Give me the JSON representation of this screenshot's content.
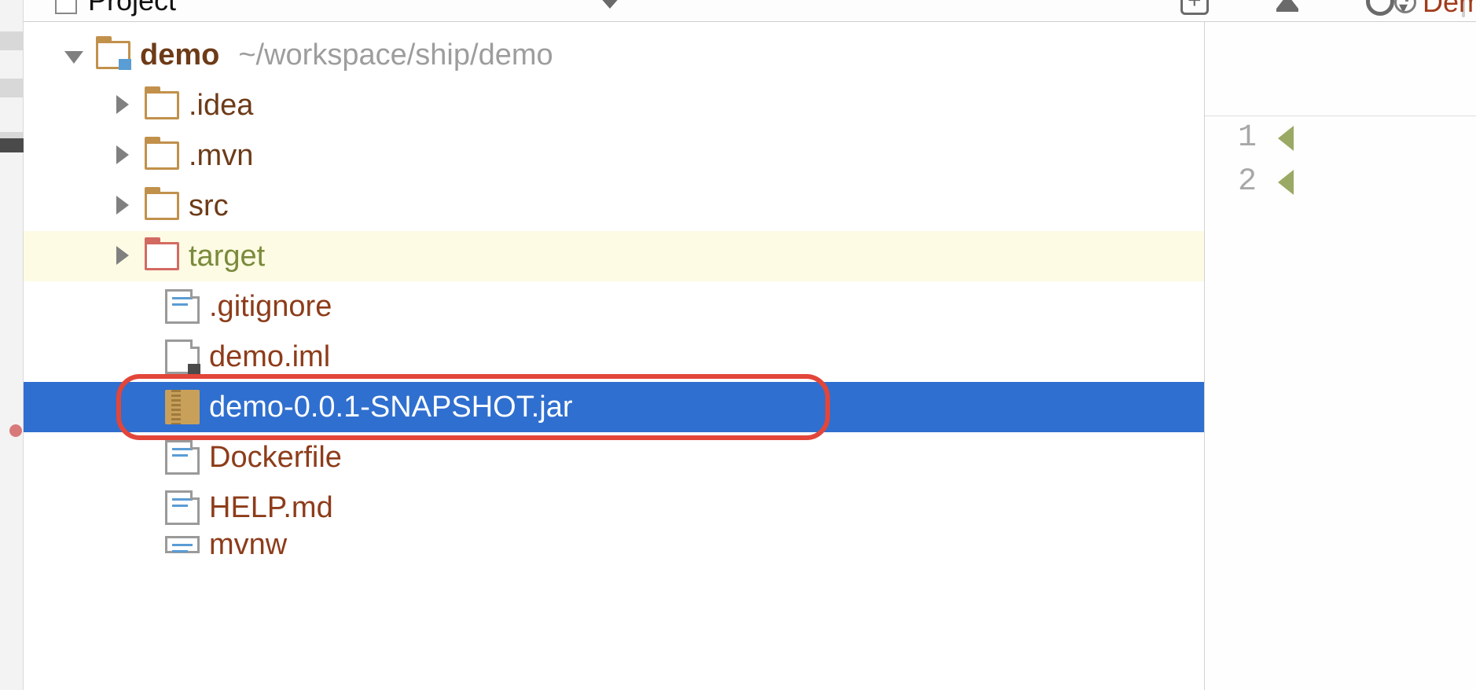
{
  "toolbar": {
    "view_label": "Project",
    "right_tab_label": "Dem"
  },
  "editor": {
    "gutter_lines": [
      "1",
      "2"
    ]
  },
  "tree": {
    "root": {
      "name": "demo",
      "path": "~/workspace/ship/demo"
    },
    "children": [
      {
        "name": ".idea",
        "kind": "folder",
        "expandable": true
      },
      {
        "name": ".mvn",
        "kind": "folder",
        "expandable": true
      },
      {
        "name": "src",
        "kind": "folder",
        "expandable": true
      },
      {
        "name": "target",
        "kind": "folder",
        "expandable": true,
        "excluded": true
      },
      {
        "name": ".gitignore",
        "kind": "file"
      },
      {
        "name": "demo.iml",
        "kind": "iml"
      },
      {
        "name": "demo-0.0.1-SNAPSHOT.jar",
        "kind": "jar",
        "selected": true,
        "annotated": true
      },
      {
        "name": "Dockerfile",
        "kind": "file"
      },
      {
        "name": "HELP.md",
        "kind": "file"
      },
      {
        "name": "mvnw",
        "kind": "file",
        "cropped": true
      }
    ]
  }
}
